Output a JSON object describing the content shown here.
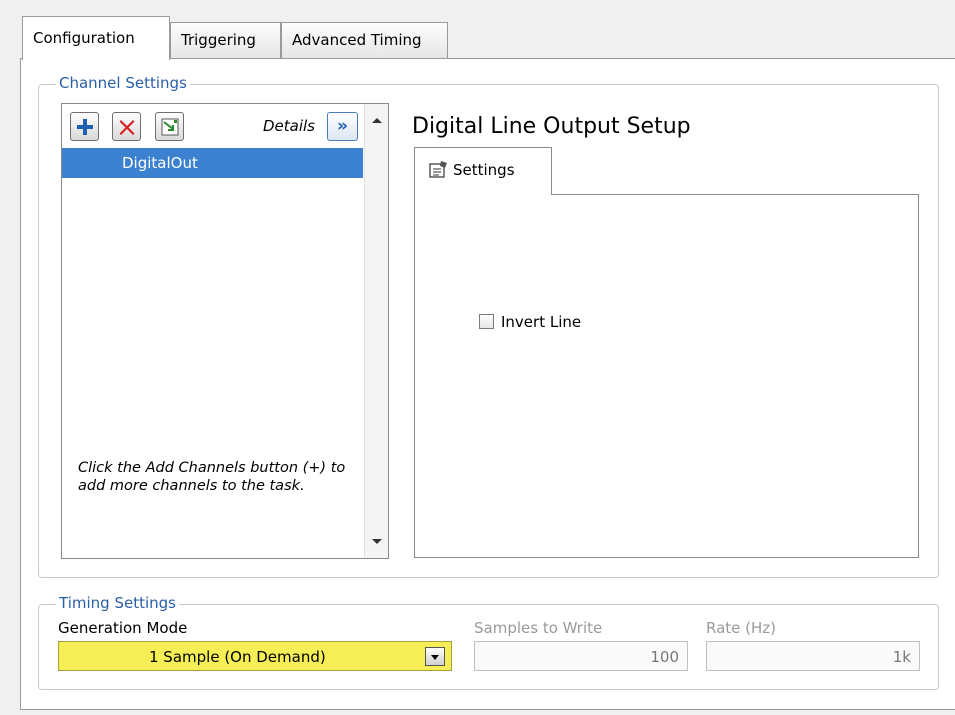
{
  "tabs": [
    {
      "label": "Configuration",
      "active": true
    },
    {
      "label": "Triggering",
      "active": false
    },
    {
      "label": "Advanced Timing",
      "active": false
    }
  ],
  "channel_settings": {
    "title": "Channel Settings",
    "toolbar": {
      "add_icon": "plus-icon",
      "remove_icon": "x-icon",
      "other_icon": "add-channels-dialog-icon",
      "details_label": "Details",
      "details_button": "»"
    },
    "channels": [
      "DigitalOut"
    ],
    "hint": "Click the Add Channels button (+) to add more channels to the task."
  },
  "setup": {
    "title": "Digital Line Output Setup",
    "tab_label": "Settings",
    "tab_icon": "settings-icon",
    "invert_line_label": "Invert Line",
    "invert_line_checked": false
  },
  "timing": {
    "title": "Timing Settings",
    "generation_mode_label": "Generation Mode",
    "generation_mode_value": "1 Sample (On Demand)",
    "samples_label": "Samples to Write",
    "samples_value": "100",
    "rate_label": "Rate (Hz)",
    "rate_value": "1k"
  },
  "colors": {
    "group_title": "#2a5fa8",
    "selection": "#3c80d0",
    "dropdown_bg": "#f5ef55"
  }
}
